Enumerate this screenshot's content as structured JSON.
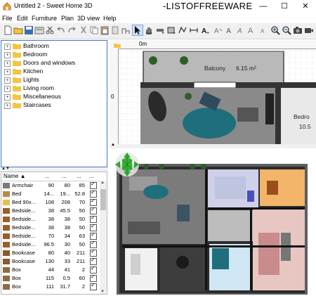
{
  "window": {
    "title": "Untitled 2 - Sweet Home 3D",
    "watermark": "-LISTOFFREEWARE",
    "minimize": "—",
    "maximize": "☐",
    "close": "✕"
  },
  "menu": {
    "items": [
      "File",
      "Edit",
      "Furniture",
      "Plan",
      "3D view",
      "Help"
    ]
  },
  "toolbar": {
    "buttons": [
      "new-icon",
      "open-icon",
      "save-icon",
      "cut-icon",
      "copy-icon",
      "paste-icon",
      "undo-icon",
      "redo-icon",
      "cut2-icon",
      "copy2-icon",
      "paste2-icon",
      "add-furniture-icon",
      "select-icon",
      "pan-icon",
      "create-walls-icon",
      "create-rooms-icon",
      "create-polylines-icon",
      "create-dimensions-icon",
      "add-text-icon",
      "text-style-icon",
      "bold-icon",
      "italic-icon",
      "increase-text-icon",
      "decrease-text-icon",
      "zoom-in-icon",
      "zoom-out-icon",
      "photo-icon",
      "video-icon"
    ]
  },
  "catalog": {
    "categories": [
      "Bathroom",
      "Bedroom",
      "Doors and windows",
      "Kitchen",
      "Lights",
      "Living room",
      "Miscellaneous",
      "Staircases"
    ]
  },
  "furniture_table": {
    "headers": {
      "name": "Name ▲",
      "width": "...",
      "depth": "...",
      "height": "...",
      "visible": "..."
    },
    "rows": [
      {
        "name": "Armchair",
        "w": "90",
        "d": "80",
        "h": "85"
      },
      {
        "name": "Bed",
        "w": "14...",
        "d": "19...",
        "h": "52.8"
      },
      {
        "name": "Bed 90x...",
        "w": "108",
        "d": "208",
        "h": "70"
      },
      {
        "name": "Bedside...",
        "w": "38",
        "d": "45.5",
        "h": "50"
      },
      {
        "name": "Bedside...",
        "w": "38",
        "d": "38",
        "h": "50"
      },
      {
        "name": "Bedside...",
        "w": "38",
        "d": "38",
        "h": "50"
      },
      {
        "name": "Bedside...",
        "w": "70",
        "d": "34",
        "h": "63"
      },
      {
        "name": "Bedside...",
        "w": "96.5",
        "d": "30",
        "h": "50"
      },
      {
        "name": "Bookcase",
        "w": "80",
        "d": "40",
        "h": "211"
      },
      {
        "name": "Bookcase",
        "w": "130",
        "d": "33",
        "h": "211"
      },
      {
        "name": "Box",
        "w": "44",
        "d": "41",
        "h": "2"
      },
      {
        "name": "Box",
        "w": "115",
        "d": "0.5",
        "h": "60"
      },
      {
        "name": "Box",
        "w": "111",
        "d": "31.7",
        "h": "2"
      }
    ]
  },
  "plan": {
    "ruler_label": "0m",
    "ruler_left_label": "0",
    "balcony_label": "Balcony",
    "balcony_area": "6.15 m²",
    "bedroom_label": "Bedro",
    "bedroom_area": "10.5"
  },
  "colors": {
    "accent": "#3d7bc9",
    "folder": "#f5c542",
    "wall_dark": "#3a3a3a",
    "teal": "#2a7f8f"
  }
}
